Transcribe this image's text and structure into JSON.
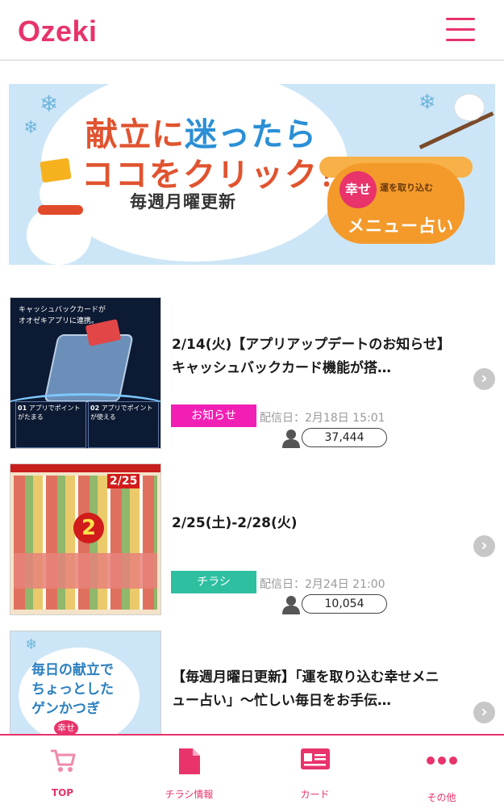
{
  "header": {
    "logo": "Ozeki"
  },
  "banner": {
    "line1_a": "献立",
    "line1_b": "に",
    "line1_c": "迷ったら",
    "line2": "ココをクリック！",
    "line3": "毎週月曜更新",
    "badge": "幸せ",
    "badge_sub": "運を取り込む",
    "pot_text": "メニュー占い"
  },
  "items": [
    {
      "title": "2/14(火)【アプリアップデートのお知らせ】キャッシュバックカード機能が搭…",
      "tag": "お知らせ",
      "tag_color": "#f21fb5",
      "date": "配信日：2月18日 15:01",
      "count": "37,444",
      "thumb": {
        "head": "キャッシュバックカードが\nオオゼキアプリに連携。",
        "box1_num": "01",
        "box1": "アプリでポイントがたまる",
        "box2_num": "02",
        "box2": "アプリでポイントが使える"
      }
    },
    {
      "title": "2/25(土)-2/28(火)",
      "tag": "チラシ",
      "tag_color": "#2ebfa1",
      "date": "配信日：2月24日 21:00",
      "count": "10,054",
      "thumb": {
        "sale": "2/25",
        "big": "2"
      }
    },
    {
      "title": "【毎週月曜日更新】「運を取り込む幸せメニュー占い」〜忙しい毎日をお手伝…",
      "thumb": {
        "text": "毎日の献立で\nちょっとした\nゲンかつぎ",
        "badge": "幸せ"
      }
    }
  ],
  "nav": [
    {
      "label": "TOP",
      "icon": "cart-icon"
    },
    {
      "label": "チラシ情報",
      "icon": "document-icon"
    },
    {
      "label": "カード",
      "icon": "card-icon"
    },
    {
      "label": "その他",
      "icon": "more-icon"
    }
  ],
  "colors": {
    "brand": "#e8336b",
    "notice": "#f21fb5",
    "flyer": "#2ebfa1"
  }
}
